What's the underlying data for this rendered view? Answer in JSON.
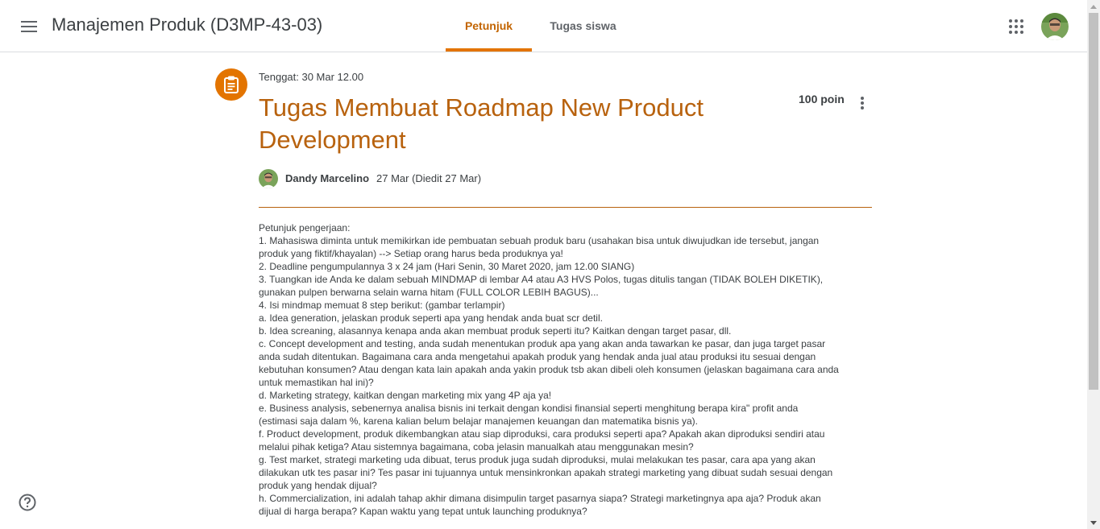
{
  "header": {
    "class_title": "Manajemen Produk (D3MP-43-03)",
    "tabs": [
      {
        "label": "Petunjuk",
        "active": true
      },
      {
        "label": "Tugas siswa",
        "active": false
      }
    ],
    "icons": [
      "menu-icon",
      "apps-icon",
      "avatar"
    ]
  },
  "assignment": {
    "due": "Tenggat: 30 Mar 12.00",
    "title_line1": "Tugas Membuat Roadmap New Product",
    "title_line2": "Development",
    "points": "100 poin",
    "author": "Dandy Marcelino",
    "posted": "27 Mar (Diedit 27 Mar)",
    "accent_color": "#e37400",
    "title_color": "#b8620e"
  },
  "instructions": {
    "lines": [
      "Petunjuk pengerjaan:",
      "1. Mahasiswa diminta untuk memikirkan ide pembuatan sebuah produk baru (usahakan bisa untuk diwujudkan ide tersebut, jangan",
      "produk yang fiktif/khayalan) --> Setiap orang harus beda produknya ya!",
      "2. Deadline pengumpulannya 3 x 24 jam (Hari Senin, 30 Maret 2020, jam 12.00 SIANG)",
      "3. Tuangkan ide Anda ke dalam sebuah MINDMAP di lembar A4 atau A3 HVS Polos, tugas ditulis tangan (TIDAK BOLEH DIKETIK),",
      "gunakan pulpen berwarna selain warna hitam (FULL COLOR LEBIH BAGUS)...",
      "4. Isi mindmap memuat 8 step berikut: (gambar terlampir)",
      "a. Idea generation, jelaskan produk seperti apa yang hendak anda buat scr detil.",
      "b. Idea screaning, alasannya kenapa anda akan membuat produk seperti itu? Kaitkan dengan target pasar, dll.",
      "c. Concept development and testing, anda sudah menentukan produk apa yang akan anda tawarkan ke pasar, dan juga target pasar",
      "anda sudah ditentukan. Bagaimana cara anda mengetahui apakah produk yang hendak anda jual atau produksi itu sesuai dengan",
      "kebutuhan konsumen? Atau dengan kata lain apakah anda yakin produk tsb akan dibeli oleh konsumen (jelaskan bagaimana cara anda",
      "untuk memastikan hal ini)?",
      "d. Marketing strategy, kaitkan dengan marketing mix yang 4P aja ya!",
      "e. Business analysis, sebenernya analisa bisnis ini terkait dengan kondisi finansial seperti menghitung berapa kira\" profit anda",
      "(estimasi saja dalam %, karena kalian belum belajar manajemen keuangan dan matematika bisnis ya).",
      "f. Product development, produk dikembangkan atau siap diproduksi, cara produksi seperti apa? Apakah akan diproduksi sendiri atau",
      "melalui pihak ketiga? Atau sistemnya bagaimana, coba jelasin manualkah atau menggunakan mesin?",
      "g. Test market, strategi marketing uda dibuat, terus produk juga sudah diproduksi, mulai melakukan tes pasar, cara apa yang akan",
      "dilakukan utk tes pasar ini? Tes pasar ini tujuannya untuk mensinkronkan apakah strategi marketing yang dibuat sudah sesuai dengan",
      "produk yang hendak dijual?",
      "h. Commercialization, ini adalah tahap akhir dimana disimpulin target pasarnya siapa? Strategi marketingnya apa aja? Produk akan",
      "dijual di harga berapa? Kapan waktu yang tepat untuk launching produknya?"
    ]
  }
}
